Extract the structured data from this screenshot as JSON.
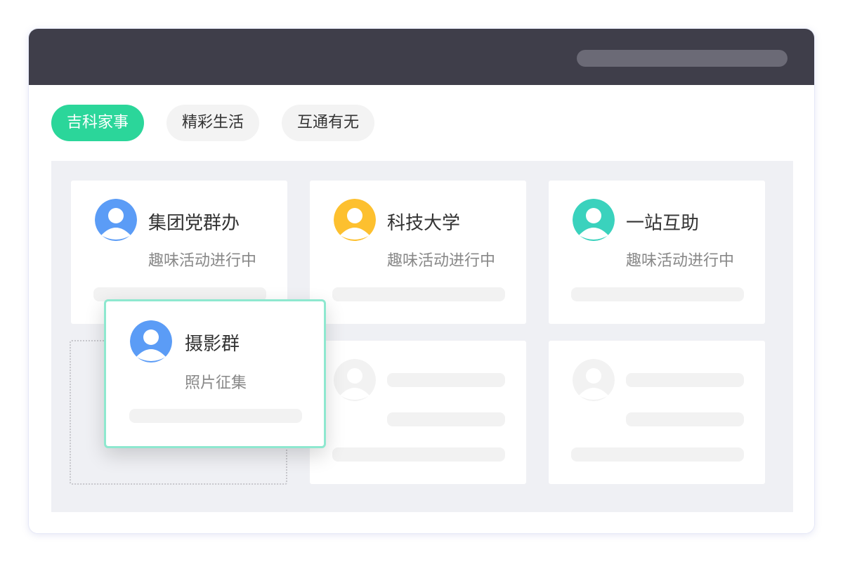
{
  "tabs": [
    {
      "label": "吉科家事",
      "active": true
    },
    {
      "label": "精彩生活",
      "active": false
    },
    {
      "label": "互通有无",
      "active": false
    }
  ],
  "cards": [
    {
      "title": "集团党群办",
      "subtitle": "趣味活动进行中",
      "avatar_color": "#5b9cf6",
      "avatar_icon": "user-icon"
    },
    {
      "title": "科技大学",
      "subtitle": "趣味活动进行中",
      "avatar_color": "#fdc02f",
      "avatar_icon": "user-icon"
    },
    {
      "title": "一站互助",
      "subtitle": "趣味活动进行中",
      "avatar_color": "#3ad2bd",
      "avatar_icon": "user-icon"
    }
  ],
  "dragging_card": {
    "title": "摄影群",
    "subtitle": "照片征集",
    "avatar_color": "#5b9cf6",
    "avatar_icon": "user-icon"
  },
  "colors": {
    "titlebar": "#3f3e4a",
    "accent": "#2bd69a",
    "drag_border": "#8ee8cf",
    "grid_background": "#eff0f4"
  }
}
